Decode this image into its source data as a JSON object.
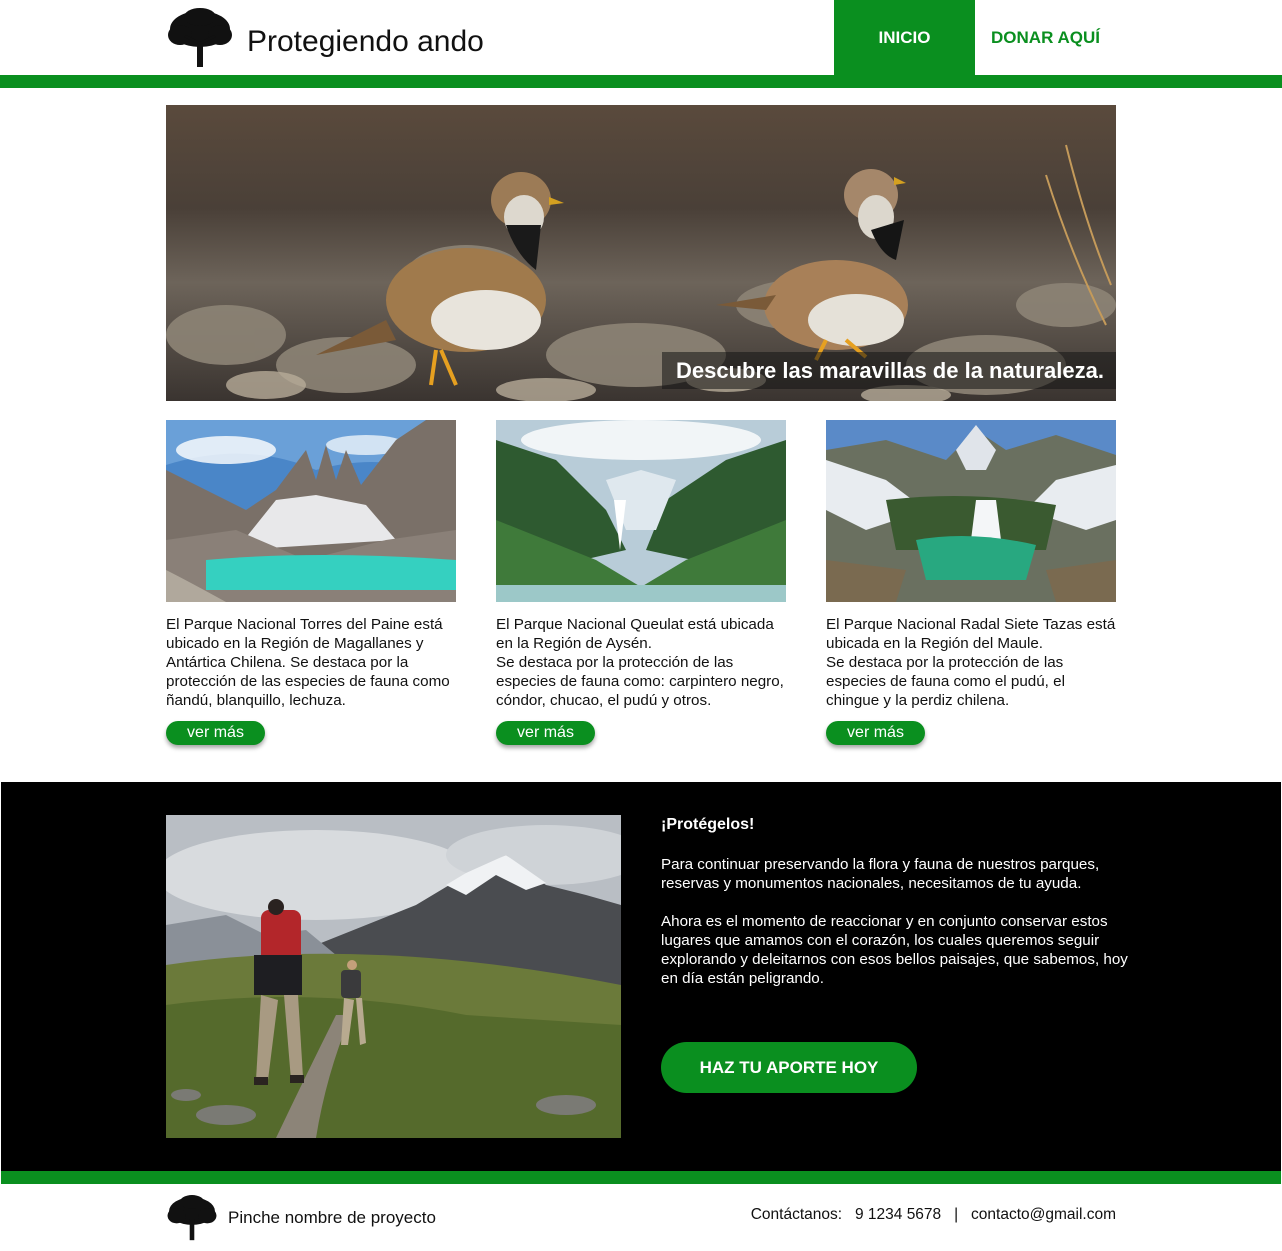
{
  "header": {
    "site_title": "Protegiendo ando",
    "nav": {
      "inicio": "INICIO",
      "donar": "DONAR AQUÍ"
    }
  },
  "hero": {
    "caption": "Descubre las maravillas de la naturaleza."
  },
  "cards": [
    {
      "text": "El Parque Nacional Torres del Paine está ubicado en la Región de Magallanes y Antártica Chilena. Se destaca por la protección de las especies de fauna como ñandú, blanquillo, lechuza.",
      "button": "ver más"
    },
    {
      "text": "El Parque Nacional Queulat está ubicada en la Región de Aysén.\nSe destaca por la protección de las especies de fauna como: carpintero negro, cóndor, chucao, el pudú y otros.",
      "button": "ver más"
    },
    {
      "text": "El Parque Nacional Radal Siete Tazas está ubicada en la Región del Maule.\nSe destaca por la protección de las especies de fauna como el pudú, el chingue y la perdiz chilena.",
      "button": "ver más"
    }
  ],
  "protect": {
    "title": "¡Protégelos!",
    "paragraph1": "Para continuar preservando la flora y fauna de nuestros parques, reservas y monumentos nacionales, necesitamos de tu ayuda.",
    "paragraph2": "Ahora es el momento de reaccionar y en conjunto conservar estos lugares que amamos con el corazón, los cuales queremos seguir explorando y deleitarnos con esos bellos paisajes, que sabemos, hoy en día están peligrando.",
    "button": "HAZ TU APORTE HOY"
  },
  "footer": {
    "project_name": "Pinche nombre de proyecto",
    "contact": "Contáctanos:   9 1234 5678   |   contacto@gmail.com"
  },
  "colors": {
    "brand_green": "#0a8f1f",
    "dark_bg": "#000000"
  },
  "icons": {
    "logo": "tree-icon"
  }
}
